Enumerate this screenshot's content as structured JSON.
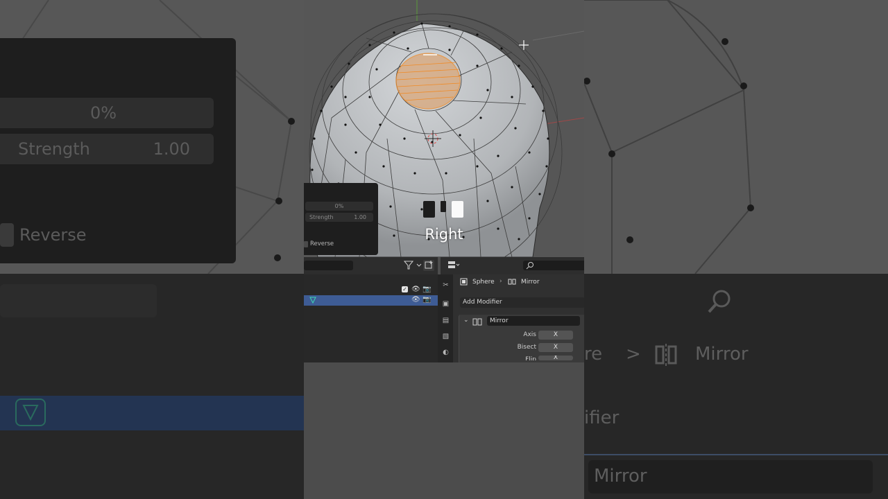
{
  "redo_panel": {
    "factor_value": "0%",
    "strength_label": "Strength",
    "strength_value": "1.00",
    "reverse_label": "Reverse"
  },
  "keycast": {
    "label": "Right"
  },
  "outliner": {
    "rows": [
      {
        "visible": true,
        "selected": false
      },
      {
        "visible": true,
        "selected": true,
        "icon": "mesh-icon"
      }
    ]
  },
  "properties": {
    "breadcrumb": {
      "object": "Sphere",
      "modifier": "Mirror"
    },
    "add_modifier_label": "Add Modifier",
    "modifier": {
      "name": "Mirror",
      "rows": [
        {
          "label": "Axis",
          "value": "X"
        },
        {
          "label": "Bisect",
          "value": "X"
        },
        {
          "label": "Flip",
          "value": "X"
        }
      ]
    }
  },
  "zoom_left": {
    "factor_value": "0%",
    "strength_label": "Strength",
    "strength_value": "1.00",
    "reverse_label": "Reverse"
  },
  "zoom_right": {
    "crumb_tail": "re",
    "modifier": "Mirror",
    "add_tail": "ifier",
    "mod_name": "Mirror"
  },
  "colors": {
    "selection": "#3e5c95",
    "selected_faces": "#e0862a",
    "viewport_bg": "#565656"
  }
}
